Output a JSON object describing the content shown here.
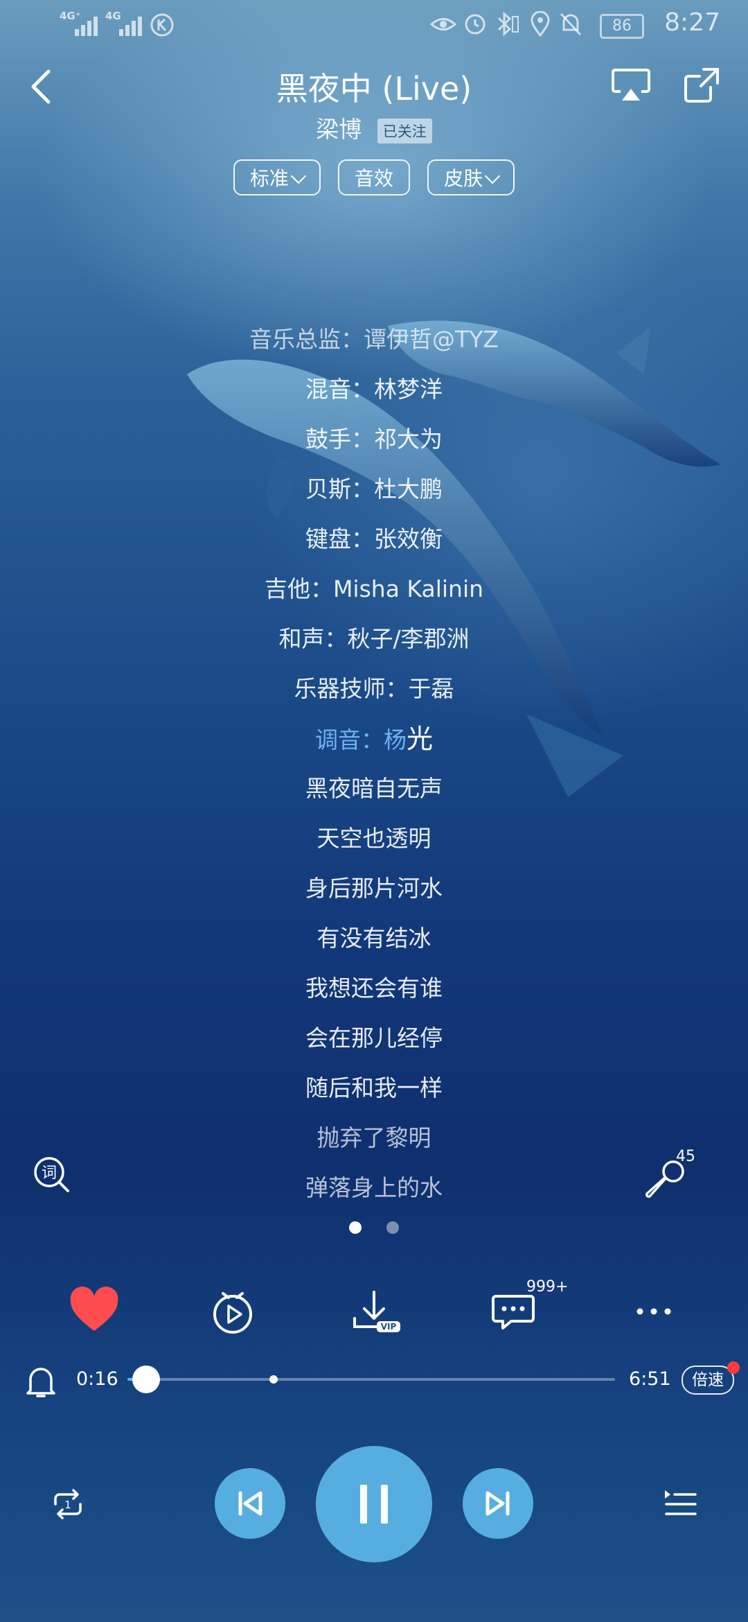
{
  "status_bar": {
    "network_1": "4G⁺",
    "network_2": "4G",
    "battery": "86",
    "time": "8:27"
  },
  "header": {
    "title": "黑夜中 (Live)",
    "artist": "梁博",
    "follow_label": "已关注",
    "pills": [
      "标准",
      "音效",
      "皮肤"
    ]
  },
  "lyrics": {
    "lines": [
      "音乐总监：谭伊哲@TYZ",
      "混音：林梦洋",
      "鼓手：祁大为",
      "贝斯：杜大鹏",
      "键盘：张效衡",
      "吉他：Misha Kalinin",
      "和声：秋子/李郡洲",
      "乐器技师：于磊"
    ],
    "active_prefix": "调音：杨",
    "active_highlight": "光",
    "after_lines": [
      "黑夜暗自无声",
      "天空也透明",
      "身后那片河水",
      "有没有结冰",
      "我想还会有谁",
      "会在那儿经停",
      "随后和我一样",
      "抛弃了黎明",
      "弹落身上的水"
    ]
  },
  "side": {
    "lyric_icon_label": "词",
    "mic_count": "45"
  },
  "actions": {
    "comment_count": "999+",
    "download_badge": "VIP"
  },
  "progress": {
    "current": "0:16",
    "total": "6:51",
    "fraction": 0.039,
    "buffered_fraction": 0.3,
    "speed_label": "倍速"
  },
  "controls": {
    "repeat_label": "1"
  },
  "colors": {
    "accent": "#56aee0",
    "active_lyric": "#6fb1ef",
    "heart": "#ff4d4f"
  }
}
